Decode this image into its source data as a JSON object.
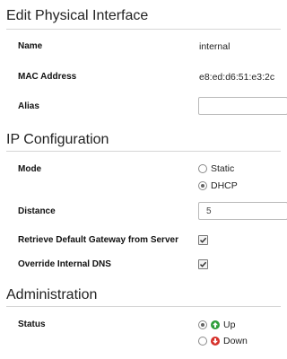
{
  "edit_section": {
    "title": "Edit Physical Interface",
    "name_label": "Name",
    "name_value": "internal",
    "mac_label": "MAC Address",
    "mac_value": "e8:ed:d6:51:e3:2c",
    "alias_label": "Alias",
    "alias_value": ""
  },
  "ip_section": {
    "title": "IP Configuration",
    "mode_label": "Mode",
    "mode_options": [
      {
        "label": "Static",
        "selected": false
      },
      {
        "label": "DHCP",
        "selected": true
      }
    ],
    "distance_label": "Distance",
    "distance_value": "5",
    "gateway_label": "Retrieve Default Gateway from Server",
    "gateway_checked": true,
    "dns_label": "Override Internal DNS",
    "dns_checked": true
  },
  "admin_section": {
    "title": "Administration",
    "status_label": "Status",
    "status_options": [
      {
        "label": "Up",
        "selected": true,
        "icon": "arrow-up-icon",
        "color": "#2e9e3a"
      },
      {
        "label": "Down",
        "selected": false,
        "icon": "arrow-down-icon",
        "color": "#d6312b"
      }
    ]
  }
}
